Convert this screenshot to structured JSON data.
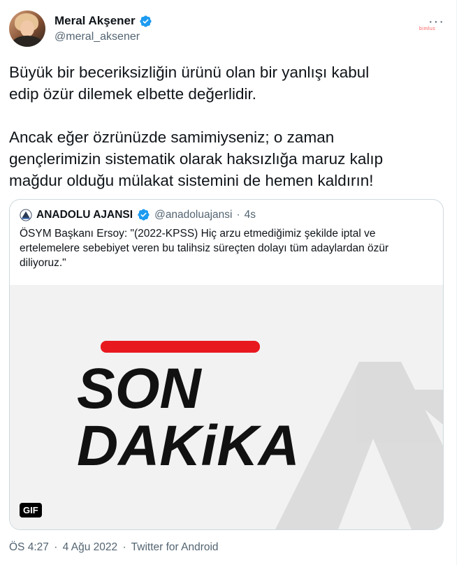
{
  "author": {
    "name": "Meral Akşener",
    "handle": "@meral_aksener"
  },
  "brand_mark": "bimlus",
  "tweet": {
    "text": "Büyük bir beceriksizliğin ürünü olan bir yanlışı kabul\nedip özür dilemek elbette değerlidir.\n\nAncak eğer özrünüzde samimiyseniz; o zaman\ngençlerimizin sistematik olarak haksızlığa maruz kalıp\nmağdur olduğu mülakat sistemini de hemen kaldırın!"
  },
  "quote": {
    "name": "ANADOLU AJANSI",
    "handle": "@anadoluajansi",
    "separator": "·",
    "time": "4s",
    "text": "ÖSYM Başkanı Ersoy: \"(2022-KPSS) Hiç arzu etmediğimiz şekilde iptal ve ertelemelere sebebiyet veren bu talihsiz süreçten dolayı tüm adaylardan özür diliyoruz.\"",
    "media": {
      "line1": "SON",
      "line2": "DAKiKA",
      "bar_color": "#e8181f",
      "badge": "GIF"
    }
  },
  "meta": {
    "time": "ÖS 4:27",
    "sep1": "·",
    "date": "4 Ağu 2022",
    "sep2": "·",
    "source": "Twitter for Android"
  },
  "colors": {
    "verified": "#1d9bf0",
    "secondary_text": "#536471"
  }
}
